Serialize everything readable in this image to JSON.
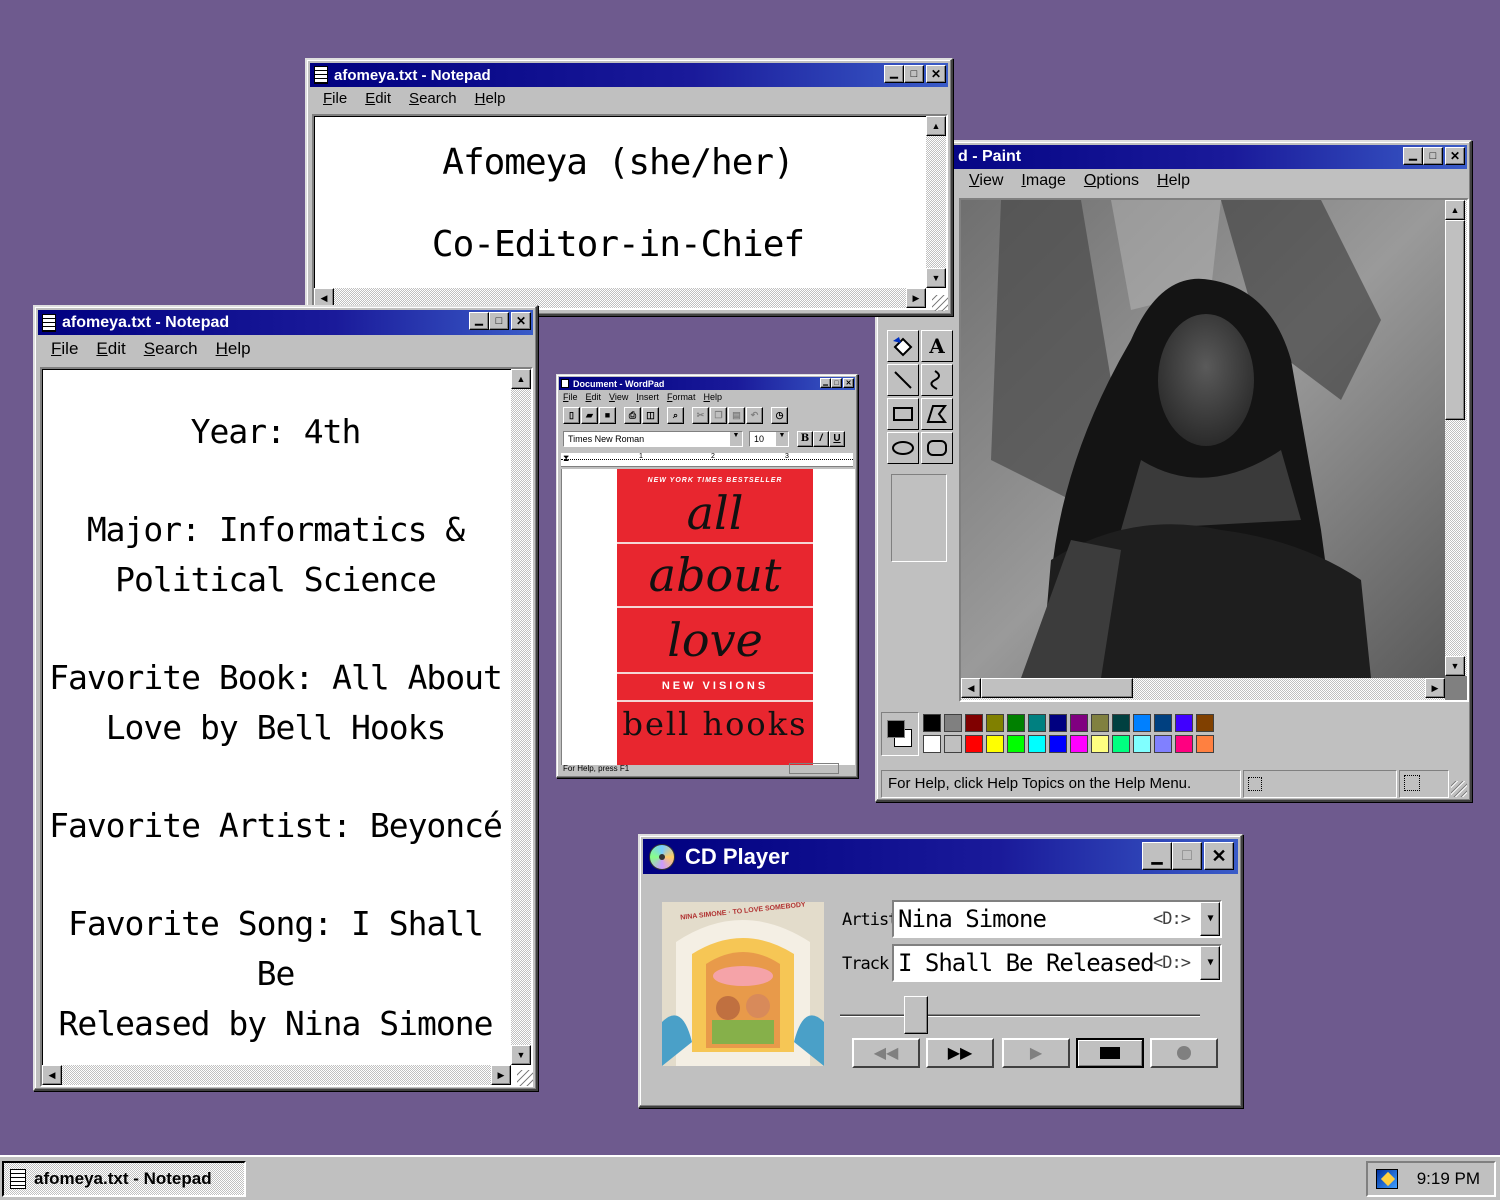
{
  "notepad_top": {
    "title": "afomeya.txt - Notepad",
    "menu": [
      "File",
      "Edit",
      "Search",
      "Help"
    ],
    "lines": [
      "Afomeya (she/her)",
      "Co-Editor-in-Chief"
    ]
  },
  "notepad_left": {
    "title": "afomeya.txt - Notepad",
    "menu": [
      "File",
      "Edit",
      "Search",
      "Help"
    ],
    "paragraphs": [
      [
        "Year: 4th"
      ],
      [
        "Major: Informatics &",
        "Political Science"
      ],
      [
        "Favorite Book: All About",
        "Love by Bell Hooks"
      ],
      [
        "Favorite Artist: Beyoncé"
      ],
      [
        "Favorite Song: I Shall Be",
        "Released by Nina Simone"
      ]
    ]
  },
  "wordpad": {
    "title": "Document - WordPad",
    "menu": [
      "File",
      "Edit",
      "View",
      "Insert",
      "Format",
      "Help"
    ],
    "font_name": "Times New Roman",
    "font_size": "10",
    "status": "For Help, press F1",
    "book_cover": {
      "banner": "NEW YORK TIMES BESTSELLER",
      "title_lines": [
        "all",
        "about",
        "love"
      ],
      "subtitle": "NEW VISIONS",
      "author": "bell hooks"
    }
  },
  "paint": {
    "title": "d - Paint",
    "menu": [
      "View",
      "Image",
      "Options",
      "Help"
    ],
    "status": "For Help, click Help Topics on the Help Menu.",
    "tools": [
      "fill-icon",
      "text-icon",
      "line-icon",
      "curve-icon",
      "rectangle-icon",
      "polygon-icon",
      "ellipse-icon",
      "rounded-rect-icon"
    ],
    "palette_top": [
      "#000000",
      "#808080",
      "#800000",
      "#808000",
      "#008000",
      "#008080",
      "#000080",
      "#800080",
      "#808040",
      "#004040",
      "#0080ff",
      "#004080",
      "#4000ff",
      "#804000"
    ],
    "palette_bottom": [
      "#ffffff",
      "#c0c0c0",
      "#ff0000",
      "#ffff00",
      "#00ff00",
      "#00ffff",
      "#0000ff",
      "#ff00ff",
      "#ffff80",
      "#00ff80",
      "#80ffff",
      "#8080ff",
      "#ff0080",
      "#ff8040"
    ]
  },
  "cdplayer": {
    "title": "CD Player",
    "artist_label": "Artist:",
    "artist": "Nina Simone",
    "track_label": "Track:",
    "track": "I Shall Be Released",
    "drive": "<D:>",
    "progress": 0.19,
    "album_text": "NINA SIMONE · TO LOVE SOMEBODY",
    "buttons": [
      "rewind-icon",
      "fast-forward-icon",
      "play-icon",
      "stop-icon",
      "eject-icon"
    ]
  },
  "taskbar": {
    "task_label": "afomeya.txt - Notepad",
    "clock": "9:19 PM"
  },
  "colors": {
    "desktop": "#6e5a8e",
    "titlebar": "#000080",
    "face": "#c0c0c0",
    "book_red": "#e8262f"
  }
}
